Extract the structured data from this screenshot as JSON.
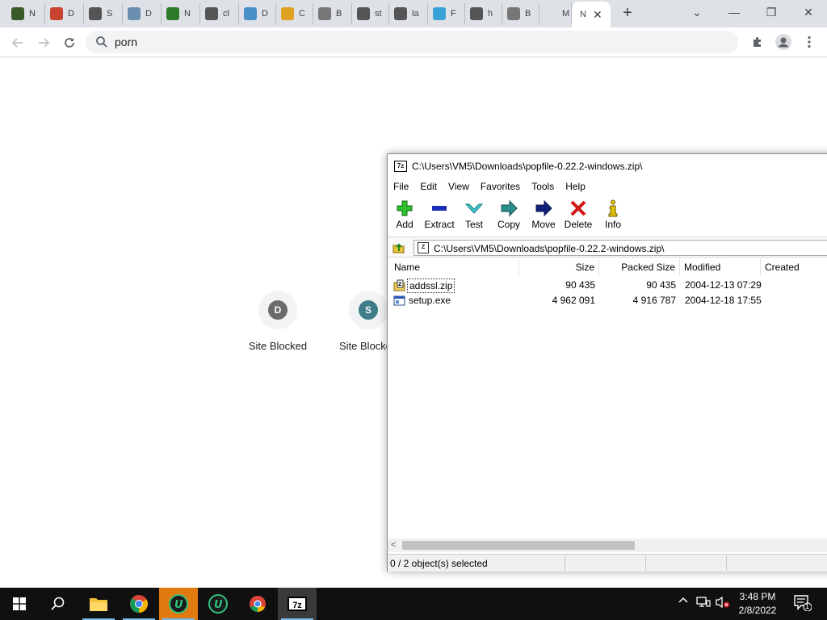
{
  "browser": {
    "tabs": [
      {
        "title": "N",
        "fav": "#3a5a2a"
      },
      {
        "title": "D",
        "fav": "#c8442f"
      },
      {
        "title": "S",
        "fav": "#555555"
      },
      {
        "title": "D",
        "fav": "#6b8fb0"
      },
      {
        "title": "N",
        "fav": "#2a7a2a"
      },
      {
        "title": "cl",
        "fav": "#555555"
      },
      {
        "title": "D",
        "fav": "#4a90c8"
      },
      {
        "title": "C",
        "fav": "#e0a020"
      },
      {
        "title": "B",
        "fav": "#777777"
      },
      {
        "title": "st",
        "fav": "#555555"
      },
      {
        "title": "la",
        "fav": "#555555"
      },
      {
        "title": "F",
        "fav": "#3aa0d8"
      },
      {
        "title": "h",
        "fav": "#555555"
      },
      {
        "title": "B",
        "fav": "#777777"
      },
      {
        "title": "M",
        "fav": "#dee1e6"
      }
    ],
    "active_tab": {
      "title": "N",
      "close": "✕"
    },
    "new_tab": "+",
    "window_controls": {
      "chevron": "⌄",
      "minimize": "—",
      "restore": "❐",
      "close": "✕"
    },
    "omnibox_value": "porn",
    "ntp_tiles": [
      {
        "letter": "D",
        "label": "Site Blocked",
        "color": "#6b6b6b"
      },
      {
        "letter": "S",
        "label": "Site Blocked",
        "color": "#3f7d8a"
      }
    ]
  },
  "sevenzip": {
    "title": "C:\\Users\\VM5\\Downloads\\popfile-0.22.2-windows.zip\\",
    "app_icon": "7z",
    "menu": [
      "File",
      "Edit",
      "View",
      "Favorites",
      "Tools",
      "Help"
    ],
    "toolbar": [
      "Add",
      "Extract",
      "Test",
      "Copy",
      "Move",
      "Delete",
      "Info"
    ],
    "address": "C:\\Users\\VM5\\Downloads\\popfile-0.22.2-windows.zip\\",
    "columns": [
      "Name",
      "Size",
      "Packed Size",
      "Modified",
      "Created"
    ],
    "rows": [
      {
        "name": "addssl.zip",
        "size": "90 435",
        "packed": "90 435",
        "modified": "2004-12-13 07:29",
        "created": ""
      },
      {
        "name": "setup.exe",
        "size": "4 962 091",
        "packed": "4 916 787",
        "modified": "2004-12-18 17:55",
        "created": ""
      }
    ],
    "status": "0 / 2 object(s) selected"
  },
  "taskbar": {
    "time": "3:48 PM",
    "date": "2/8/2022",
    "notification_count": "1",
    "sevenzip_label": "7z"
  }
}
